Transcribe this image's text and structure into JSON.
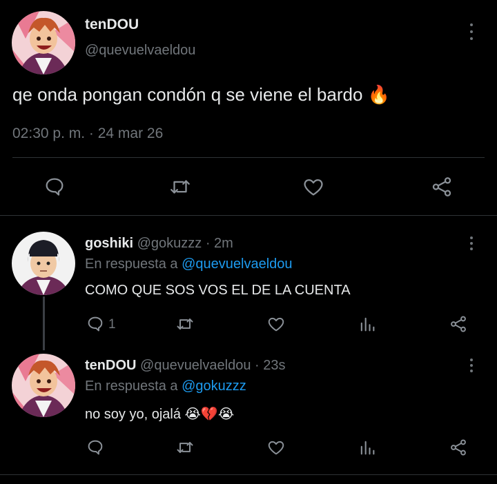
{
  "main_tweet": {
    "display_name": "tenDOU",
    "handle": "@quevuelvaeldou",
    "text": "qe onda pongan condón q se viene el bardo",
    "emoji": "🔥",
    "timestamp": "02:30 p. m. · 24 mar 26",
    "actions": [
      "reply-icon",
      "retweet-icon",
      "like-icon",
      "share-icon"
    ]
  },
  "replies": [
    {
      "display_name": "goshiki",
      "handle": "@gokuzzz",
      "time": "· 2m",
      "reply_prefix": "En respuesta a",
      "reply_to": "@quevuelvaeldou",
      "text": "COMO QUE SOS VOS EL DE LA CUENTA",
      "reply_count": "1",
      "actions": [
        "reply-icon",
        "retweet-icon",
        "like-icon",
        "analytics-icon",
        "share-icon"
      ]
    },
    {
      "display_name": "tenDOU",
      "handle": "@quevuelvaeldou",
      "time": "· 23s",
      "reply_prefix": "En respuesta a",
      "reply_to": "@gokuzzz",
      "text": "no soy yo, ojalá",
      "emojis": "😭💔😭",
      "actions": [
        "reply-icon",
        "retweet-icon",
        "like-icon",
        "analytics-icon",
        "share-icon"
      ]
    }
  ],
  "colors": {
    "background": "#000000",
    "text": "#e7e9ea",
    "muted": "#71767b",
    "link": "#1d9bf0",
    "divider": "#2f3336"
  }
}
